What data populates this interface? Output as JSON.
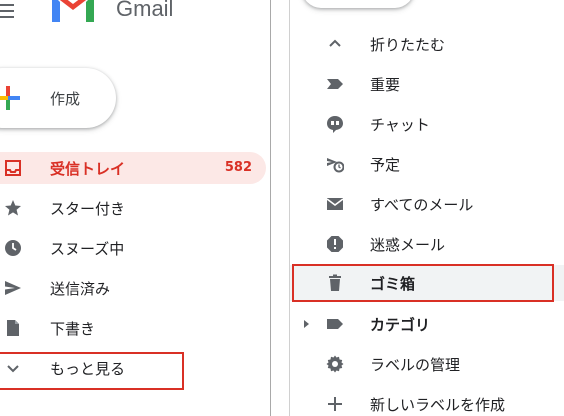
{
  "header": {
    "app_name": "Gmail"
  },
  "compose": {
    "label": "作成"
  },
  "left_nav": [
    {
      "label": "受信トレイ",
      "count": "582",
      "icon": "inbox-icon",
      "active": true
    },
    {
      "label": "スター付き",
      "icon": "star-icon"
    },
    {
      "label": "スヌーズ中",
      "icon": "clock-icon"
    },
    {
      "label": "送信済み",
      "icon": "send-icon"
    },
    {
      "label": "下書き",
      "icon": "draft-icon"
    },
    {
      "label": "もっと見る",
      "icon": "chevron-down-icon"
    }
  ],
  "right_nav": [
    {
      "label": "折りたたむ",
      "icon": "chevron-up-icon"
    },
    {
      "label": "重要",
      "icon": "important-icon"
    },
    {
      "label": "チャット",
      "icon": "chat-icon"
    },
    {
      "label": "予定",
      "icon": "scheduled-icon"
    },
    {
      "label": "すべてのメール",
      "icon": "all-mail-icon"
    },
    {
      "label": "迷惑メール",
      "icon": "spam-icon"
    },
    {
      "label": "ゴミ箱",
      "icon": "trash-icon"
    },
    {
      "label": "カテゴリ",
      "icon": "label-icon"
    },
    {
      "label": "ラベルの管理",
      "icon": "gear-icon"
    },
    {
      "label": "新しいラベルを作成",
      "icon": "plus-icon"
    }
  ],
  "colors": {
    "accent": "#d93025",
    "active_bg": "#fce8e6",
    "icon": "#5f6368",
    "highlight_box": "#d93025"
  }
}
